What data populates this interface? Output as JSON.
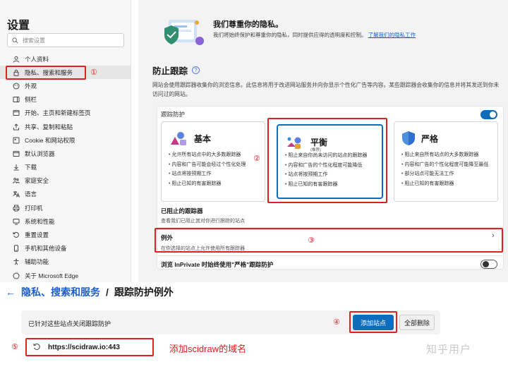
{
  "sidebar": {
    "title": "设置",
    "search_placeholder": "搜索设置",
    "items": [
      {
        "label": "个人资料",
        "icon": "profile-icon"
      },
      {
        "label": "隐私、搜索和服务",
        "icon": "lock-icon"
      },
      {
        "label": "外观",
        "icon": "appearance-icon"
      },
      {
        "label": "侧栏",
        "icon": "sidebar-icon"
      },
      {
        "label": "开始、主页和新建标签页",
        "icon": "home-icon"
      },
      {
        "label": "共享、复制和粘贴",
        "icon": "share-icon"
      },
      {
        "label": "Cookie 和网站权限",
        "icon": "cookie-icon"
      },
      {
        "label": "默认浏览器",
        "icon": "browser-icon"
      },
      {
        "label": "下载",
        "icon": "download-icon"
      },
      {
        "label": "家庭安全",
        "icon": "family-icon"
      },
      {
        "label": "语言",
        "icon": "language-icon"
      },
      {
        "label": "打印机",
        "icon": "printer-icon"
      },
      {
        "label": "系统和性能",
        "icon": "system-icon"
      },
      {
        "label": "重置设置",
        "icon": "reset-icon"
      },
      {
        "label": "手机和其他设备",
        "icon": "phone-icon"
      },
      {
        "label": "辅助功能",
        "icon": "accessibility-icon"
      },
      {
        "label": "关于 Microsoft Edge",
        "icon": "edge-icon"
      }
    ]
  },
  "privacy": {
    "title": "我们尊重你的隐私。",
    "desc": "我们将始终保护和尊重你的隐私，同时提供应得的透明度和控制。",
    "link": "了解我们的隐私工作"
  },
  "tracking": {
    "title": "防止跟踪",
    "help_glyph": "?",
    "desc": "网站会使用跟踪器收集你的浏览信息。此信息将用于改进网站服务并向你显示个性化广告等内容。某些跟踪器会收集你的信息并将其发送到你未访问过的网站。",
    "card_label": "跟踪防护",
    "options": [
      {
        "name": "基本",
        "tag": "",
        "bullets": [
          "允许所有站点中的大多数跟踪器",
          "内容和广告可能会经过个性化处理",
          "站点将按预期工作",
          "阻止已知的有害跟踪器"
        ]
      },
      {
        "name": "平衡",
        "tag": "(推荐)",
        "bullets": [
          "阻止来自你尚未访问的站点的跟踪器",
          "内容和广告的个性化程度可能降低",
          "站点将按预期工作",
          "阻止已知的有害跟踪器"
        ]
      },
      {
        "name": "严格",
        "tag": "",
        "bullets": [
          "阻止来自所有站点的大多数跟踪器",
          "内容和广告的个性化程度可能降至最低",
          "部分站点可能无法工作",
          "阻止已知的有害跟踪器"
        ]
      }
    ],
    "blocked_title": "已阻止的跟踪器",
    "blocked_sub": "查看我们已阻止其对你进行跟踪的站点",
    "exceptions_title": "例外",
    "exceptions_sub": "在你选择的站点上允许使用所有跟踪器",
    "inprivate_label": "浏览 InPrivate 时始终使用\"严格\"跟踪防护",
    "chevron": "›"
  },
  "annotations": {
    "m1": "①",
    "m2": "②",
    "m3": "③",
    "m4": "④",
    "m5": "⑤",
    "caption": "添加scidraw的域名"
  },
  "exceptions_page": {
    "back": "←",
    "crumb_link": "隐私、搜索和服务",
    "crumb_sep": "/",
    "crumb_current": "跟踪防护例外",
    "section_label": "已针对这些站点关闭跟踪防护",
    "add_button": "添加站点",
    "delete_all_button": "全部删除",
    "site": "https://scidraw.io:443"
  },
  "watermark": "知乎用户",
  "colors": {
    "accent": "#0f6cbd",
    "annotation": "#e02020",
    "link": "#1b5dd1"
  }
}
